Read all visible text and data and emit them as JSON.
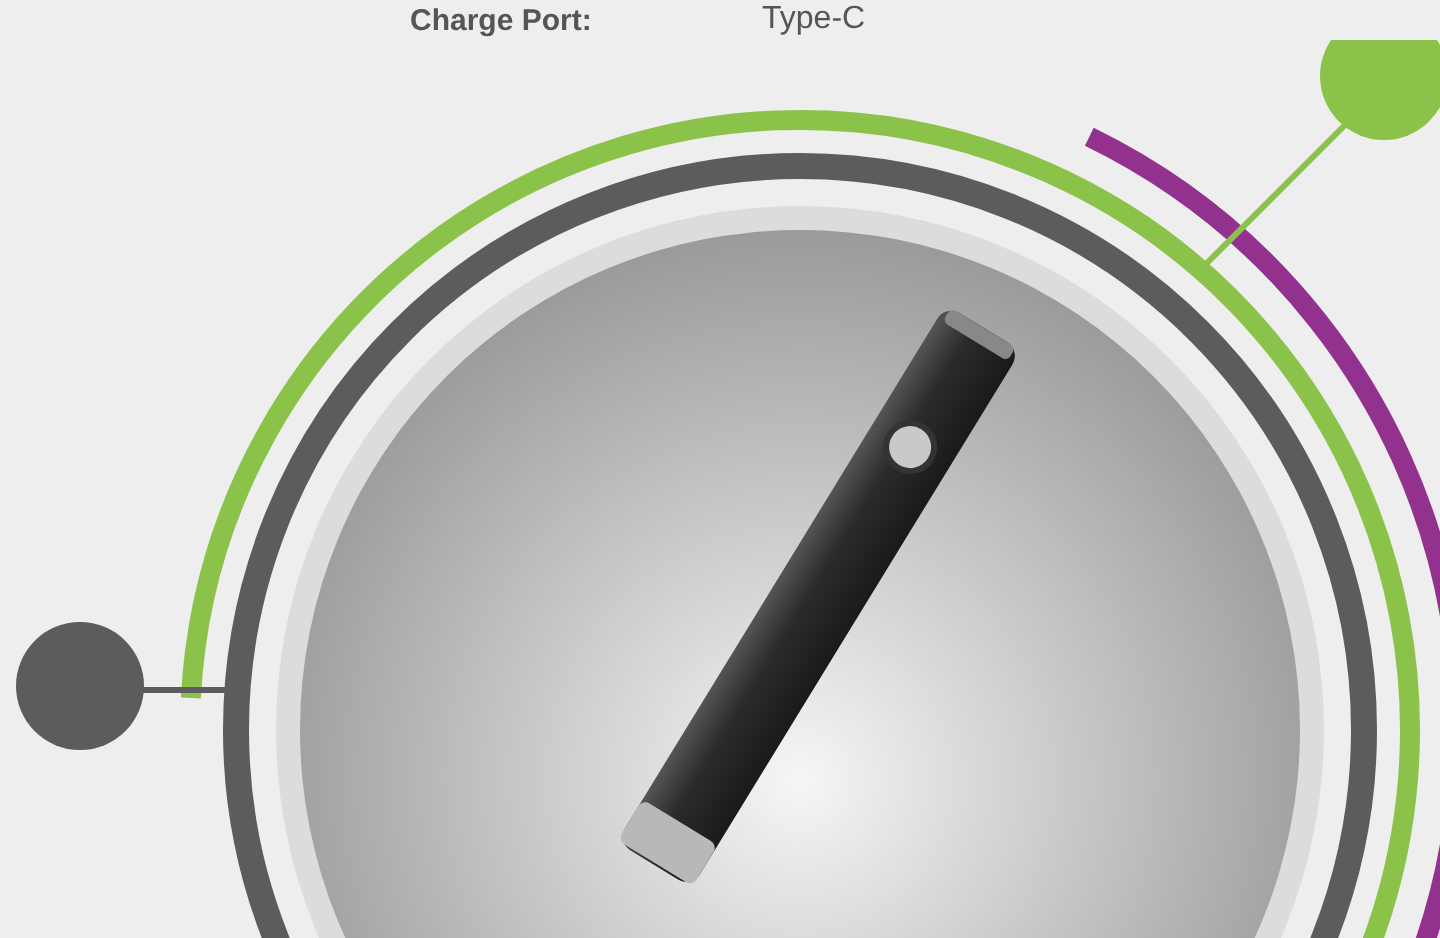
{
  "spec": {
    "label": "Charge Port:",
    "value": "Type-C"
  }
}
